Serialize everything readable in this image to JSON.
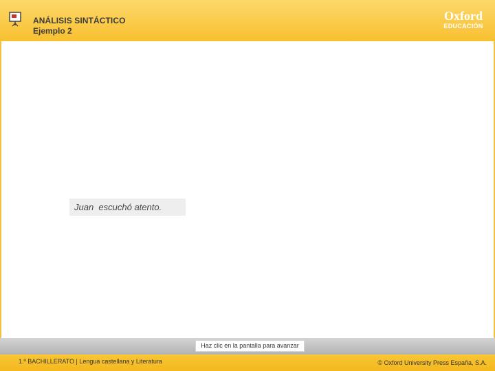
{
  "header": {
    "title": "ANÁLISIS SINTÁCTICO",
    "subtitle": "Ejemplo 2",
    "logo_brand": "Oxford",
    "logo_sub": "EDUCACIÓN",
    "presenter_icon": "presenter-board-icon"
  },
  "main": {
    "sentence": "Juan  escuchó atento."
  },
  "nav": {
    "advance_hint": "Haz clic en la pantalla para avanzar"
  },
  "footer": {
    "course": "1.º BACHILLERATO | Lengua castellana y Literatura",
    "copyright": "© Oxford University Press España, S.A."
  },
  "colors": {
    "header_yellow": "#f8c030",
    "footer_yellow": "#f4b81f",
    "frame_border": "#f0c040",
    "nav_gray": "#b3b3b3"
  }
}
